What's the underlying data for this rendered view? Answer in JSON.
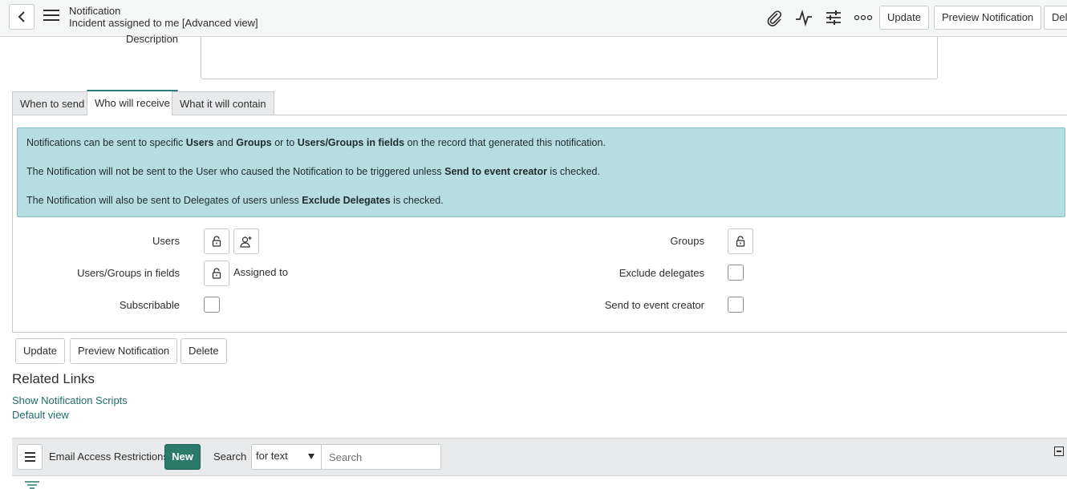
{
  "header": {
    "title": "Notification",
    "subtitle": "Incident assigned to me [Advanced view]",
    "buttons": {
      "update": "Update",
      "preview": "Preview Notification",
      "delete_partial": "Del"
    }
  },
  "form": {
    "description_label": "Description"
  },
  "tabs": [
    {
      "label": "When to send"
    },
    {
      "label": "Who will receive"
    },
    {
      "label": "What it will contain"
    }
  ],
  "info": {
    "line1": {
      "a": "Notifications can be sent to specific ",
      "b1": "Users",
      "c": " and ",
      "b2": "Groups",
      "d": " or to ",
      "b3": "Users/Groups in fields",
      "e": " on the record that generated this notification."
    },
    "line2": {
      "a": "The Notification will not be sent to the User who caused the Notification to be triggered unless ",
      "b": "Send to event creator",
      "c": " is checked."
    },
    "line3": {
      "a": "The Notification will also be sent to Delegates of users unless ",
      "b": "Exclude Delegates",
      "c": " is checked."
    }
  },
  "fields": {
    "users": "Users",
    "users_groups_in_fields": "Users/Groups in fields",
    "users_groups_value": "Assigned to",
    "subscribable": "Subscribable",
    "groups": "Groups",
    "exclude_delegates": "Exclude delegates",
    "send_to_event_creator": "Send to event creator"
  },
  "actions": {
    "update": "Update",
    "preview": "Preview Notification",
    "delete": "Delete"
  },
  "related_links": {
    "title": "Related Links",
    "links": [
      "Show Notification Scripts",
      "Default view"
    ]
  },
  "related_list": {
    "name": "Email Access Restrictions",
    "new_label": "New",
    "search_label": "Search",
    "search_select": "for text",
    "search_placeholder": "Search"
  },
  "colors": {
    "accent": "#2c7a6b",
    "info_bg": "#b5dde2",
    "link": "#1f6b6e"
  }
}
